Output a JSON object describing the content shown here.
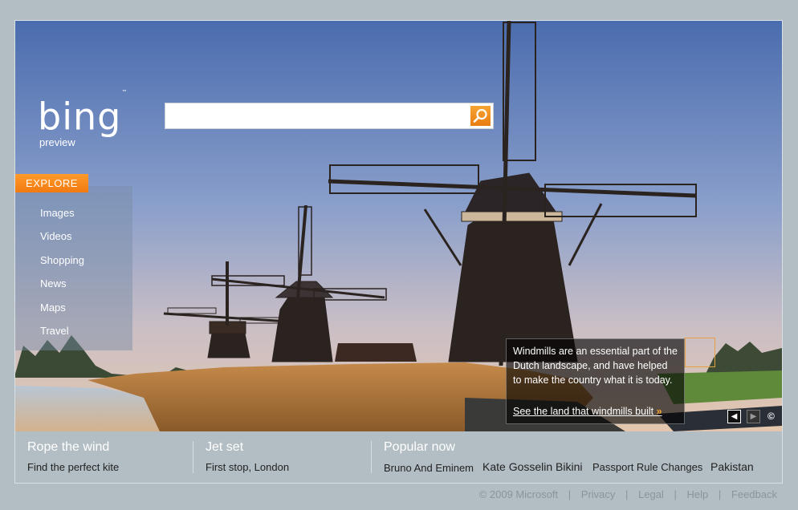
{
  "logo": {
    "text": "bing",
    "tm": "™",
    "subtitle": "preview"
  },
  "search": {
    "value": "",
    "placeholder": ""
  },
  "explore": {
    "label": "EXPLORE",
    "items": [
      "Images",
      "Videos",
      "Shopping",
      "News",
      "Maps",
      "Travel"
    ]
  },
  "caption": {
    "text": "Windmills are an essential part of the Dutch landscape, and have helped to make the country what it is today.",
    "link": "See the land that windmills built",
    "link_arrow": "»"
  },
  "image_nav": {
    "prev": "◀",
    "next": "▶",
    "copyright": "©"
  },
  "bottom": {
    "col1": {
      "title": "Rope the wind",
      "subtitle": "Find the perfect kite"
    },
    "col2": {
      "title": "Jet set",
      "subtitle": "First stop, London"
    },
    "col3": {
      "title": "Popular now",
      "items": [
        "Bruno And Eminem",
        "Kate Gosselin Bikini",
        "Passport Rule Changes",
        "Pakistan"
      ]
    }
  },
  "footer": {
    "copyright": "© 2009 Microsoft",
    "links": [
      "Privacy",
      "Legal",
      "Help",
      "Feedback"
    ],
    "separator": "|"
  },
  "colors": {
    "accent_orange": "#f08a1c",
    "page_bg": "#b3bec4",
    "sky_top": "#4e6fb0",
    "sky_bottom": "#d9c2b4"
  },
  "icons": [
    "search-icon",
    "prev-arrow-icon",
    "next-arrow-icon",
    "copyright-icon"
  ]
}
